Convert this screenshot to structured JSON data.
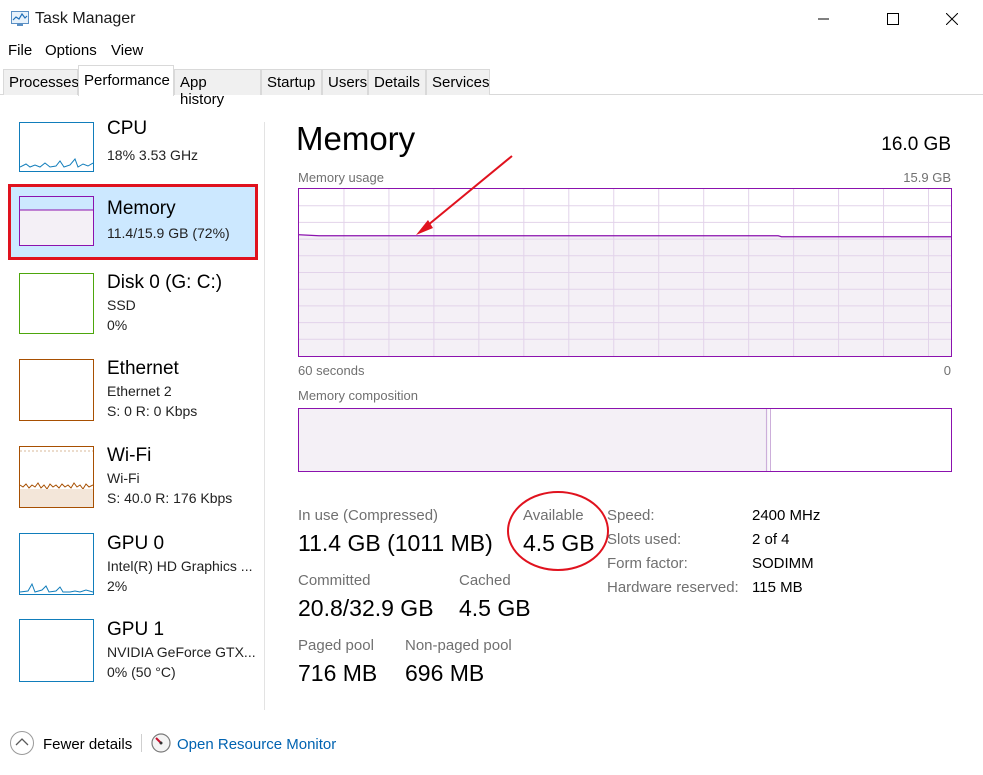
{
  "window": {
    "title": "Task Manager",
    "controls": [
      "minimize",
      "maximize",
      "close"
    ]
  },
  "menu": {
    "items": [
      "File",
      "Options",
      "View"
    ]
  },
  "tabs": {
    "items": [
      "Processes",
      "Performance",
      "App history",
      "Startup",
      "Users",
      "Details",
      "Services"
    ],
    "active": "Performance"
  },
  "sidebar": {
    "items": [
      {
        "title": "CPU",
        "line1": "18%  3.53 GHz",
        "line2": "",
        "color": "#117dbb",
        "selected": false
      },
      {
        "title": "Memory",
        "line1": "11.4/15.9 GB (72%)",
        "line2": "",
        "color": "#8b12ae",
        "selected": true
      },
      {
        "title": "Disk 0 (G: C:)",
        "line1": "SSD",
        "line2": "0%",
        "color": "#4da60c",
        "selected": false
      },
      {
        "title": "Ethernet",
        "line1": "Ethernet 2",
        "line2": "S: 0  R: 0 Kbps",
        "color": "#a74f01",
        "selected": false
      },
      {
        "title": "Wi-Fi",
        "line1": "Wi-Fi",
        "line2": "S: 40.0  R: 176 Kbps",
        "color": "#a74f01",
        "selected": false
      },
      {
        "title": "GPU 0",
        "line1": "Intel(R) HD Graphics ...",
        "line2": "2%",
        "color": "#117dbb",
        "selected": false
      },
      {
        "title": "GPU 1",
        "line1": "NVIDIA GeForce GTX...",
        "line2": "0%  (50 °C)",
        "color": "#117dbb",
        "selected": false
      }
    ]
  },
  "memory": {
    "title": "Memory",
    "total": "16.0 GB",
    "usage_caption": "Memory usage",
    "usage_max": "15.9 GB",
    "time_left": "60 seconds",
    "time_right": "0",
    "composition_caption": "Memory composition",
    "usage_level_fraction": 0.72,
    "composition_in_use_fraction": 0.72,
    "stats": {
      "in_use_label": "In use (Compressed)",
      "in_use_value": "11.4 GB (1011 MB)",
      "available_label": "Available",
      "available_value": "4.5 GB",
      "committed_label": "Committed",
      "committed_value": "20.8/32.9 GB",
      "cached_label": "Cached",
      "cached_value": "4.5 GB",
      "paged_label": "Paged pool",
      "paged_value": "716 MB",
      "nonpaged_label": "Non-paged pool",
      "nonpaged_value": "696 MB"
    },
    "specs": {
      "speed_label": "Speed:",
      "speed_value": "2400 MHz",
      "slots_label": "Slots used:",
      "slots_value": "2 of 4",
      "form_label": "Form factor:",
      "form_value": "SODIMM",
      "reserved_label": "Hardware reserved:",
      "reserved_value": "115 MB"
    }
  },
  "footer": {
    "fewer_details": "Fewer details",
    "open_resmon": "Open Resource Monitor"
  },
  "colors": {
    "memory_accent": "#8b12ae",
    "memory_fill": "#f4f0f6",
    "selection_bg": "#cce8ff",
    "annotation_red": "#e0121e",
    "link_blue": "#0063b1"
  }
}
